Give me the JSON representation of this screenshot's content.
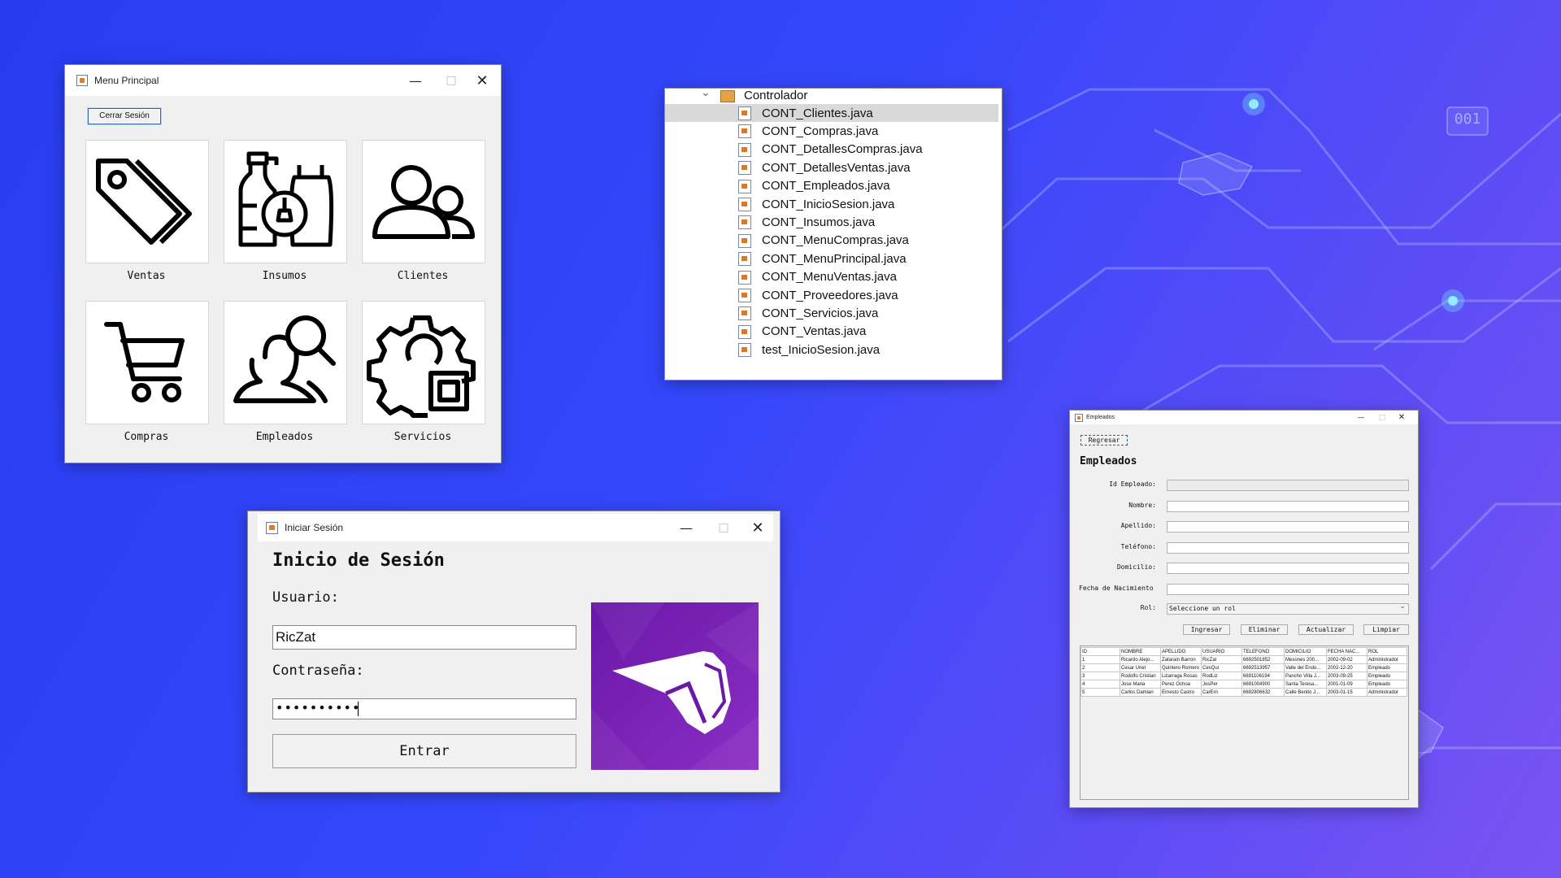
{
  "menu_principal": {
    "title": "Menu Principal",
    "logout_button": "Cerrar Sesión",
    "tiles": [
      {
        "label": "Ventas",
        "icon": "price-tag-icon"
      },
      {
        "label": "Insumos",
        "icon": "cleaning-supplies-icon"
      },
      {
        "label": "Clientes",
        "icon": "users-icon"
      },
      {
        "label": "Compras",
        "icon": "shopping-cart-icon"
      },
      {
        "label": "Empleados",
        "icon": "user-search-icon"
      },
      {
        "label": "Servicios",
        "icon": "gear-icon"
      }
    ]
  },
  "project_tree": {
    "folder": "Controlador",
    "files": [
      "CONT_Clientes.java",
      "CONT_Compras.java",
      "CONT_DetallesCompras.java",
      "CONT_DetallesVentas.java",
      "CONT_Empleados.java",
      "CONT_InicioSesion.java",
      "CONT_Insumos.java",
      "CONT_MenuCompras.java",
      "CONT_MenuPrincipal.java",
      "CONT_MenuVentas.java",
      "CONT_Proveedores.java",
      "CONT_Servicios.java",
      "CONT_Ventas.java",
      "test_InicioSesion.java"
    ]
  },
  "login": {
    "window_title": "Iniciar Sesión",
    "heading": "Inicio de Sesión",
    "user_label": "Usuario:",
    "user_value": "RicZat",
    "password_label": "Contraseña:",
    "password_value": "••••••••••",
    "submit": "Entrar"
  },
  "empleados": {
    "window_title": "Empleados",
    "back_button": "Regresar",
    "heading": "Empleados",
    "fields": {
      "id": "Id Empleado:",
      "nombre": "Nombre:",
      "apellido": "Apellido:",
      "telefono": "Teléfono:",
      "domicilio": "Domicilio:",
      "fecha": "Fecha de Nacimiento",
      "rol": "Rol:"
    },
    "rol_placeholder": "Seleccione un rol",
    "buttons": {
      "ingresar": "Ingresar",
      "eliminar": "Eliminar",
      "actualizar": "Actualizar",
      "limpiar": "Limpiar"
    },
    "table": {
      "headers": [
        "ID",
        "NOMBRE",
        "APELLIDO",
        "USUARIO",
        "TELEFONO",
        "DOMICILIO",
        "FECHA NAC...",
        "ROL"
      ],
      "rows": [
        [
          "1",
          "Ricardo Alejo...",
          "Zatarain Barron",
          "RicZat",
          "6692501852",
          "Mesones 200...",
          "2002-09-02",
          "Administrador"
        ],
        [
          "2",
          "Cesar Uriel",
          "Quintero Romero",
          "CesQui",
          "6692513957",
          "Valle del Endo...",
          "2002-12-20",
          "Empleado"
        ],
        [
          "3",
          "Rodolfo Cristian",
          "Lizarraga Rosas",
          "RodLiz",
          "6691106194",
          "Pancho Villa J...",
          "2003-09-25",
          "Empleado"
        ],
        [
          "4",
          "Jose Maria",
          "Perez Ochoa",
          "JosPer",
          "6691004900",
          "Santa Teresa...",
          "2001-01-09",
          "Empleado"
        ],
        [
          "5",
          "Carlos Damian",
          "Ernesto Castro",
          "CarErn",
          "6692806632",
          "Calle Benito J...",
          "2003-01-15",
          "Administrador"
        ]
      ]
    }
  },
  "decor": {
    "badge": "001"
  }
}
